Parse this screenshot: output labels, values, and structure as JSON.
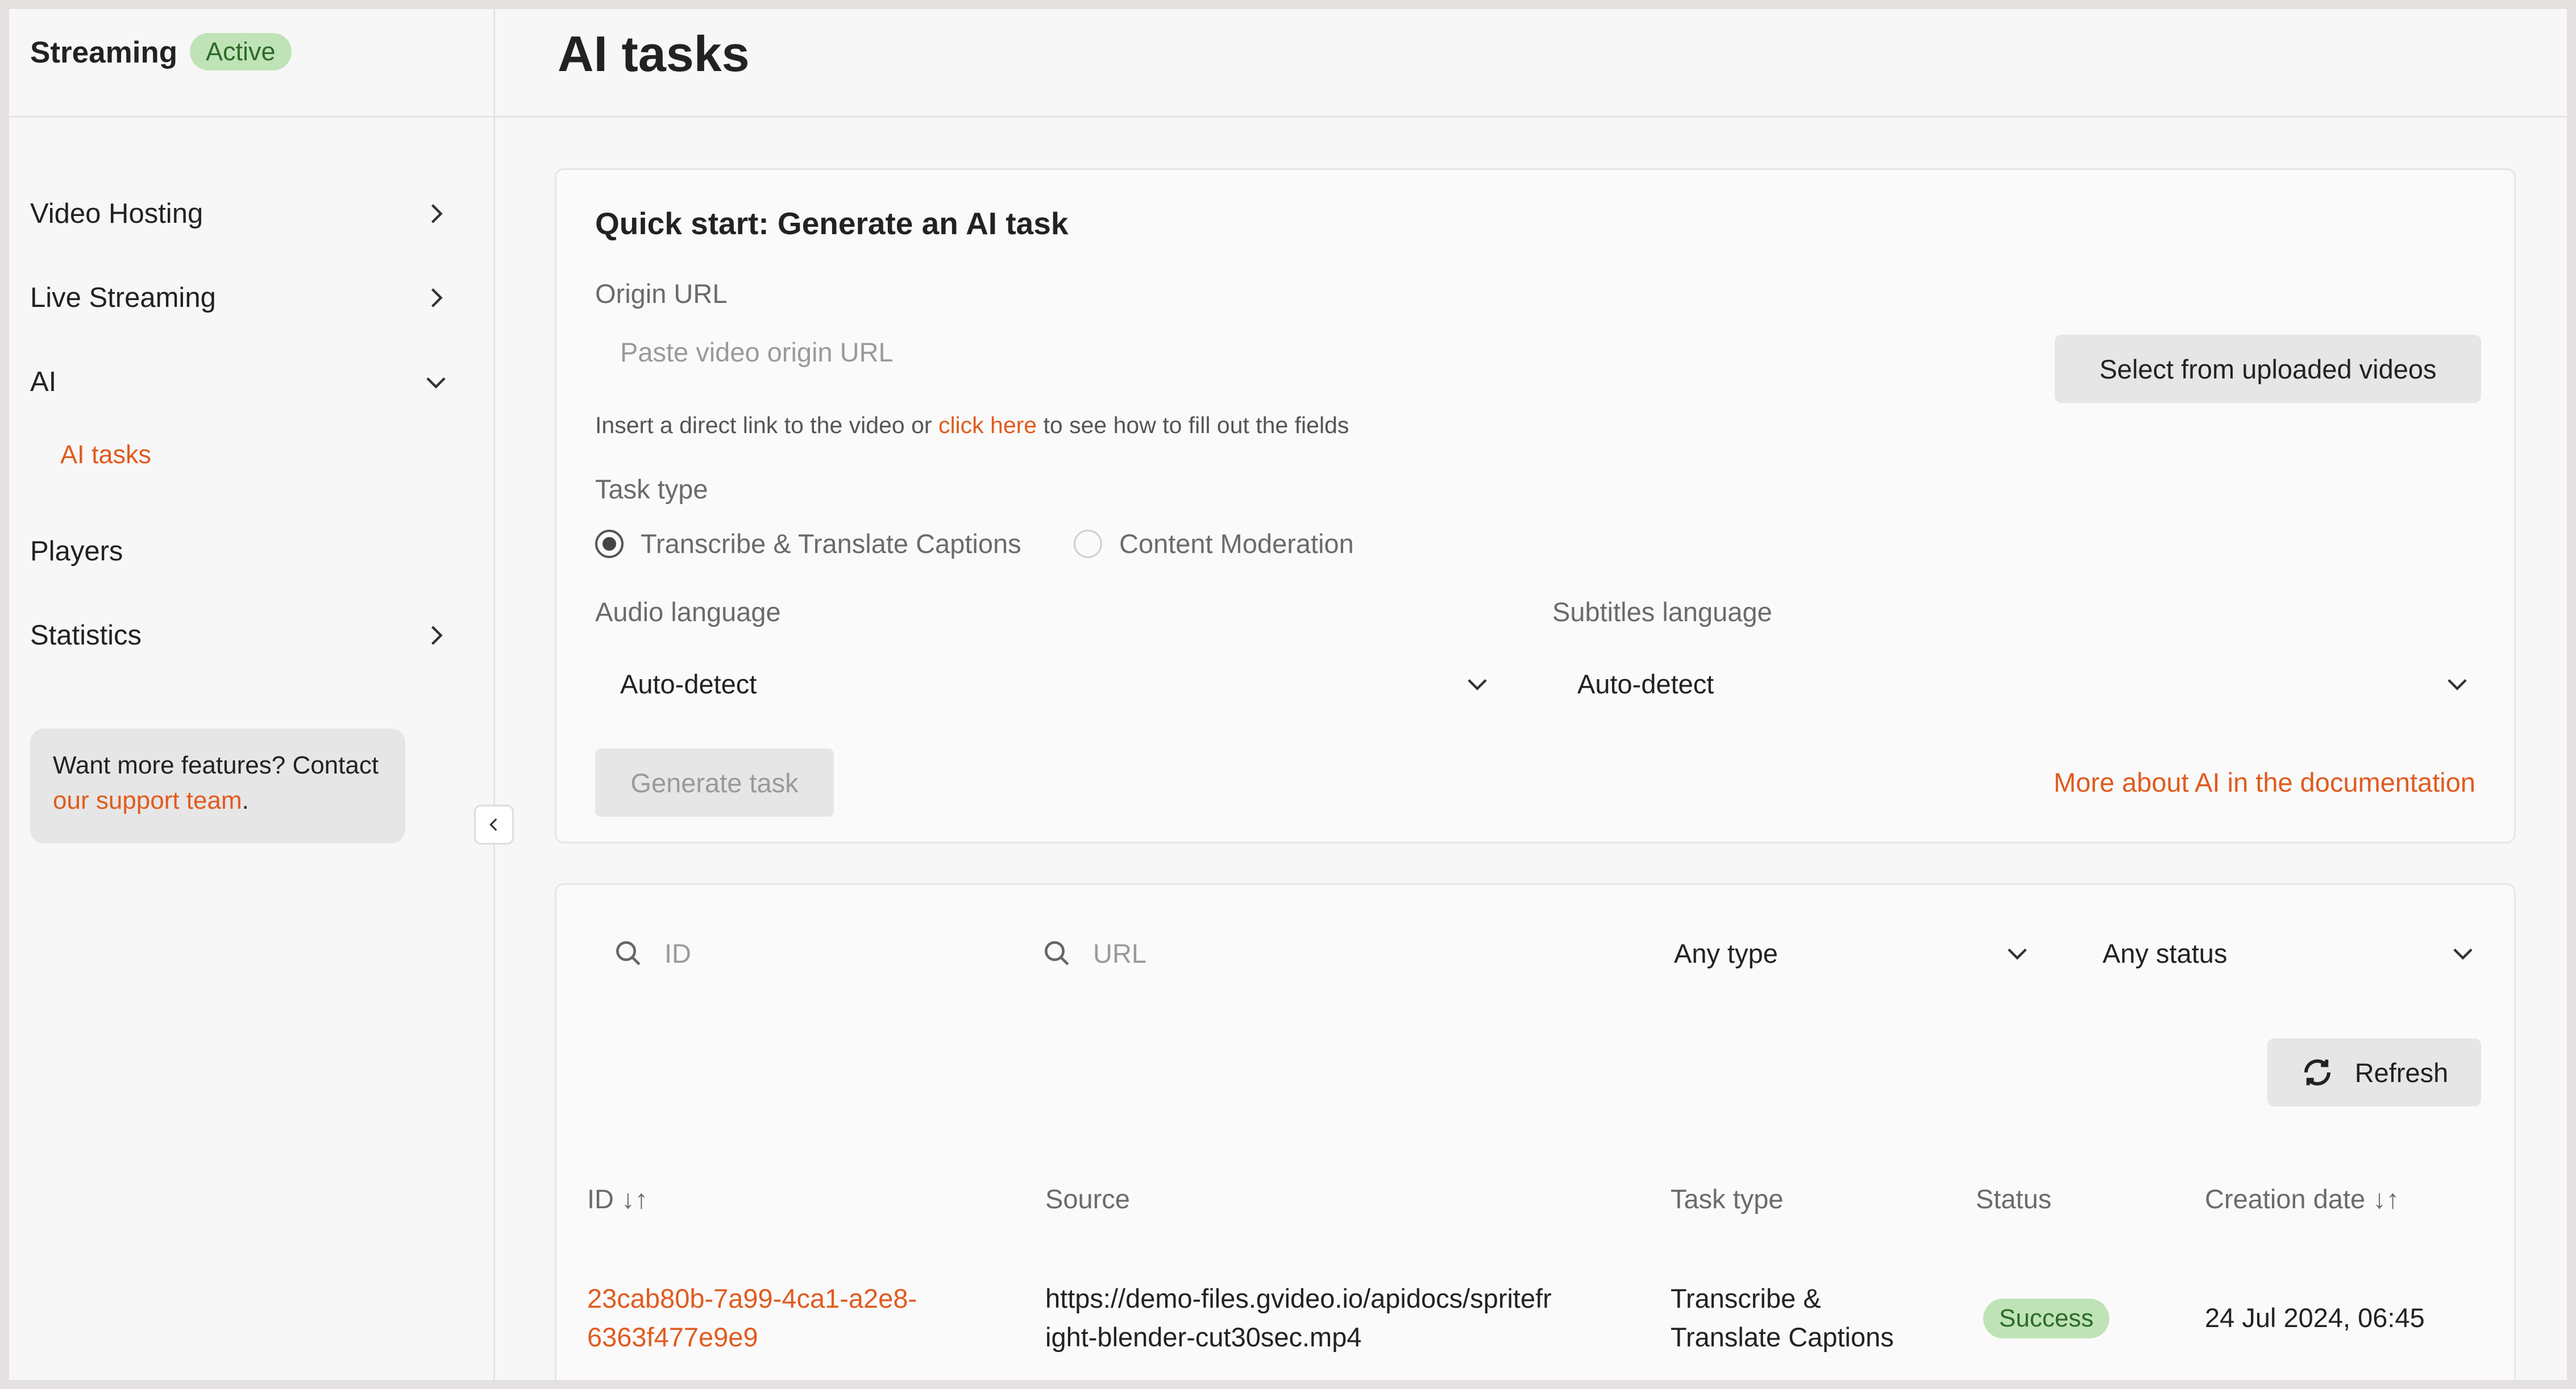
{
  "sidebar": {
    "brand": "Streaming",
    "badge": "Active",
    "items": [
      {
        "label": "Video Hosting"
      },
      {
        "label": "Live Streaming"
      },
      {
        "label": "AI"
      },
      {
        "label": "Players"
      },
      {
        "label": "Statistics"
      }
    ],
    "sub_item": "AI tasks",
    "promo": {
      "text": "Want more features? Contact",
      "link": "our support team",
      "suffix": "."
    }
  },
  "header": {
    "title": "AI tasks"
  },
  "quick_start": {
    "title": "Quick start: Generate an AI task",
    "origin_label": "Origin URL",
    "origin_placeholder": "Paste video origin URL",
    "select_button": "Select from uploaded videos",
    "hint_prefix": "Insert a direct link to the video or",
    "hint_link": "click here",
    "hint_suffix": "to see how to fill out the fields",
    "task_type_label": "Task type",
    "task_types": [
      {
        "label": "Transcribe & Translate Captions",
        "selected": true
      },
      {
        "label": "Content Moderation",
        "selected": false
      }
    ],
    "audio_label": "Audio language",
    "audio_value": "Auto-detect",
    "subtitles_label": "Subtitles language",
    "subtitles_value": "Auto-detect",
    "generate_button": "Generate task",
    "doc_link": "More about AI in the documentation"
  },
  "filters": {
    "id_placeholder": "ID",
    "url_placeholder": "URL",
    "type_value": "Any type",
    "status_value": "Any status",
    "refresh_label": "Refresh"
  },
  "table": {
    "headers": {
      "id": "ID ↓↑",
      "source": "Source",
      "task_type": "Task type",
      "status": "Status",
      "created": "Creation date ↓↑"
    },
    "rows": [
      {
        "id_line1": "23cab80b-7a99-4ca1-a2e8-",
        "id_line2": "6363f477e9e9",
        "source_line1": "https://demo-files.gvideo.io/apidocs/spritefr",
        "source_line2": "ight-blender-cut30sec.mp4",
        "type_line1": "Transcribe &",
        "type_line2": "Translate Captions",
        "status": "Success",
        "created": "24 Jul 2024, 06:45"
      }
    ]
  },
  "colors": {
    "accent": "#e15b1f",
    "success_bg": "#bfe3b6",
    "success_text": "#2d6a2a"
  }
}
